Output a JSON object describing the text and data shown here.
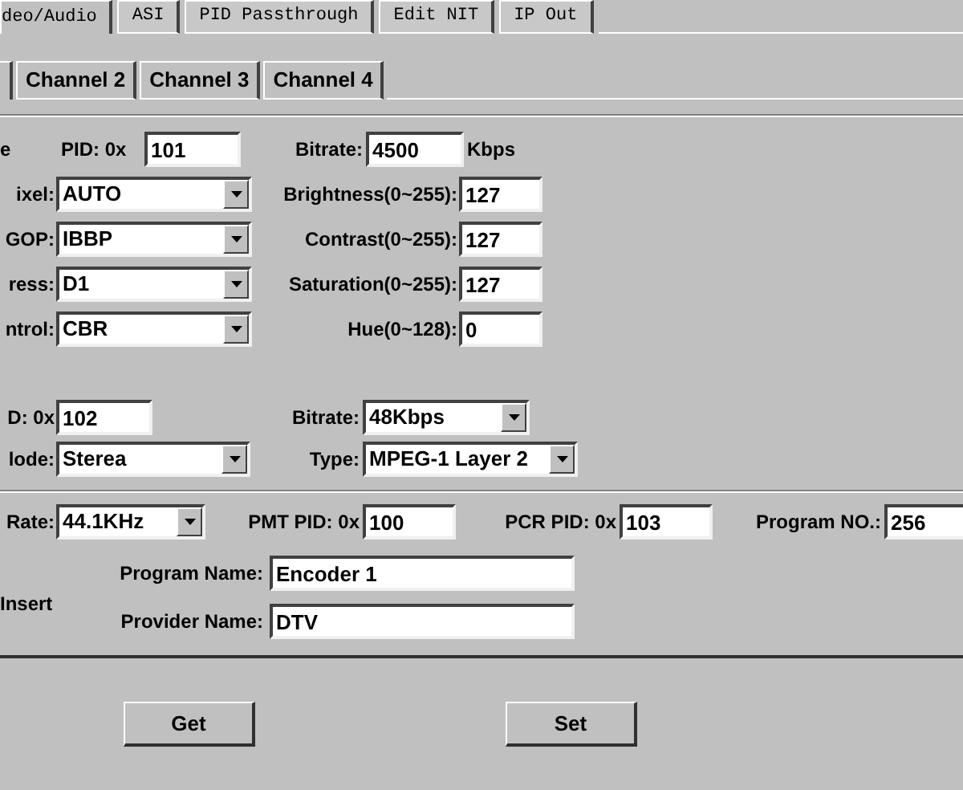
{
  "top_tabs": [
    {
      "label": "deo/Audio",
      "selected": true
    },
    {
      "label": "ASI",
      "selected": false
    },
    {
      "label": "PID Passthrough",
      "selected": false
    },
    {
      "label": "Edit NIT",
      "selected": false
    },
    {
      "label": "IP Out",
      "selected": false
    }
  ],
  "channel_tabs": [
    {
      "selected": true
    },
    {
      "label": "Channel 2",
      "selected": false
    },
    {
      "label": "Channel 3",
      "selected": false
    },
    {
      "label": "Channel 4",
      "selected": false
    }
  ],
  "video": {
    "row_label": "e",
    "pid_label": "PID: 0x",
    "pid": "101",
    "bitrate_label": "Bitrate:",
    "bitrate": "4500",
    "bitrate_unit": "Kbps",
    "settings": [
      {
        "label": "ixel:",
        "value": "AUTO",
        "adjust_label": "Brightness(0~255):",
        "adjust_value": "127"
      },
      {
        "label": "GOP:",
        "value": "IBBP",
        "adjust_label": "Contrast(0~255):",
        "adjust_value": "127"
      },
      {
        "label": "ress:",
        "value": "D1",
        "adjust_label": "Saturation(0~255):",
        "adjust_value": "127"
      },
      {
        "label": "ntrol:",
        "value": "CBR",
        "adjust_label": "Hue(0~128):",
        "adjust_value": "0"
      }
    ]
  },
  "audio": {
    "pid_label": "D: 0x",
    "pid": "102",
    "bitrate_label": "Bitrate:",
    "bitrate": "48Kbps",
    "mode_label": "lode:",
    "mode": "Sterea",
    "type_label": "Type:",
    "type": "MPEG-1 Layer 2",
    "rate_label": "Rate:",
    "rate": "44.1KHz"
  },
  "program": {
    "pmt_label": "PMT PID: 0x",
    "pmt": "100",
    "pcr_label": "PCR PID: 0x",
    "pcr": "103",
    "number_label": "Program NO.:",
    "number": "256",
    "insert_label": "Insert",
    "name_label": "Program Name:",
    "name": "Encoder 1",
    "provider_label": "Provider Name:",
    "provider": "DTV"
  },
  "buttons": [
    "Get",
    "Set"
  ]
}
